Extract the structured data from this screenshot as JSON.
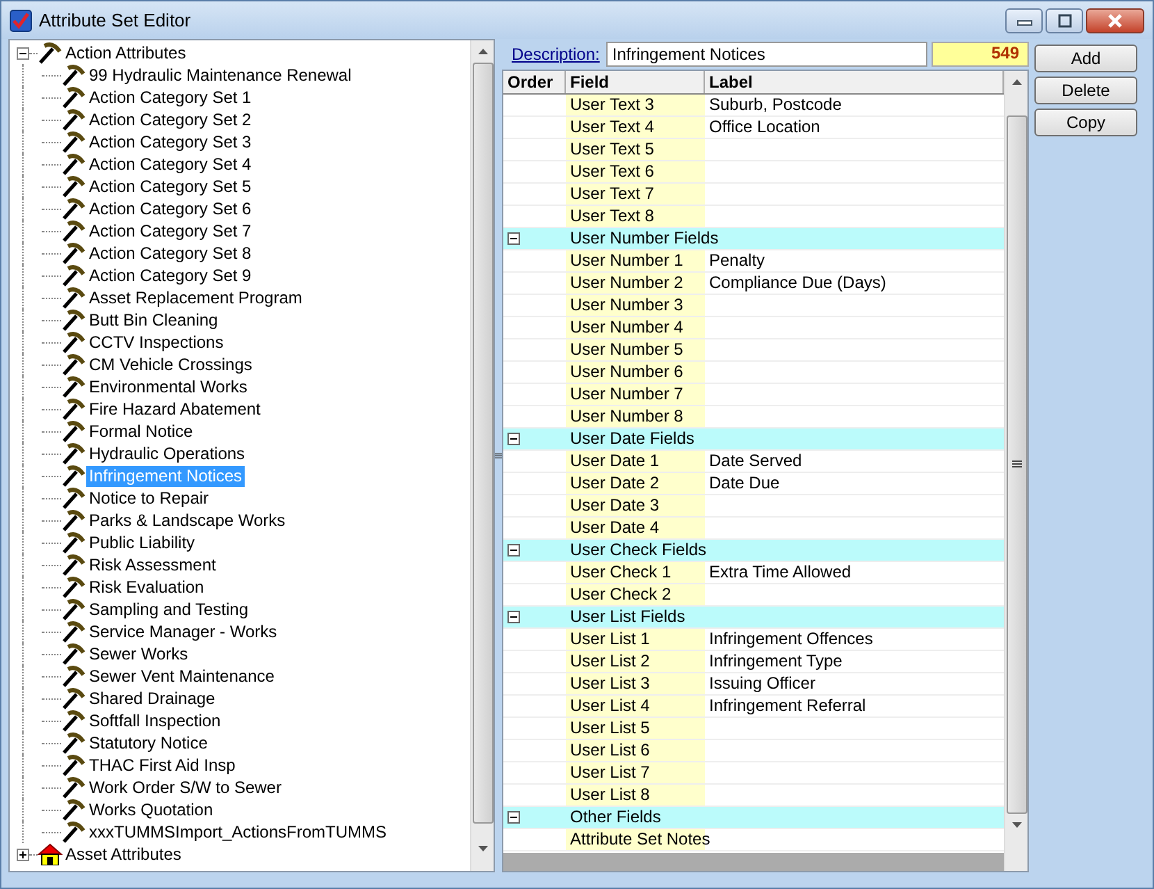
{
  "window": {
    "title": "Attribute Set Editor"
  },
  "tree": [
    {
      "label": "Action Attributes",
      "kind": "action",
      "expanded": true,
      "selected": false,
      "children": [
        {
          "label": "99 Hydraulic Maintenance Renewal",
          "selected": false
        },
        {
          "label": "Action Category Set 1",
          "selected": false
        },
        {
          "label": "Action Category Set 2",
          "selected": false
        },
        {
          "label": "Action Category Set 3",
          "selected": false
        },
        {
          "label": "Action Category Set 4",
          "selected": false
        },
        {
          "label": "Action Category Set 5",
          "selected": false
        },
        {
          "label": "Action Category Set 6",
          "selected": false
        },
        {
          "label": "Action Category Set 7",
          "selected": false
        },
        {
          "label": "Action Category Set 8",
          "selected": false
        },
        {
          "label": "Action Category Set 9",
          "selected": false
        },
        {
          "label": "Asset Replacement Program",
          "selected": false
        },
        {
          "label": "Butt Bin Cleaning",
          "selected": false
        },
        {
          "label": "CCTV Inspections",
          "selected": false
        },
        {
          "label": "CM Vehicle Crossings",
          "selected": false
        },
        {
          "label": "Environmental Works",
          "selected": false
        },
        {
          "label": "Fire Hazard Abatement",
          "selected": false
        },
        {
          "label": "Formal Notice",
          "selected": false
        },
        {
          "label": "Hydraulic Operations",
          "selected": false
        },
        {
          "label": "Infringement Notices",
          "selected": true
        },
        {
          "label": "Notice to Repair",
          "selected": false
        },
        {
          "label": "Parks & Landscape Works",
          "selected": false
        },
        {
          "label": "Public Liability",
          "selected": false
        },
        {
          "label": "Risk Assessment",
          "selected": false
        },
        {
          "label": "Risk Evaluation",
          "selected": false
        },
        {
          "label": "Sampling and Testing",
          "selected": false
        },
        {
          "label": "Service Manager - Works",
          "selected": false
        },
        {
          "label": "Sewer  Works",
          "selected": false
        },
        {
          "label": "Sewer Vent Maintenance",
          "selected": false
        },
        {
          "label": "Shared Drainage",
          "selected": false
        },
        {
          "label": "Softfall Inspection",
          "selected": false
        },
        {
          "label": "Statutory Notice",
          "selected": false
        },
        {
          "label": "THAC First Aid Insp",
          "selected": false
        },
        {
          "label": "Work Order S/W to Sewer",
          "selected": false
        },
        {
          "label": "Works Quotation",
          "selected": false
        },
        {
          "label": "xxxTUMMSImport_ActionsFromTUMMS",
          "selected": false
        }
      ]
    },
    {
      "label": "Asset Attributes",
      "kind": "asset",
      "expanded": false,
      "selected": false
    }
  ],
  "description": {
    "label": "Description:",
    "value": "Infringement Notices",
    "id_badge": "549"
  },
  "buttons": [
    "Add",
    "Delete",
    "Copy"
  ],
  "grid": {
    "columns": [
      "Order",
      "Field",
      "Label"
    ],
    "rows": [
      {
        "kind": "field",
        "field": "User Text 3",
        "label": "Suburb, Postcode"
      },
      {
        "kind": "field",
        "field": "User Text 4",
        "label": "Office Location"
      },
      {
        "kind": "field",
        "field": "User Text 5"
      },
      {
        "kind": "field",
        "field": "User Text 6"
      },
      {
        "kind": "field",
        "field": "User Text 7"
      },
      {
        "kind": "field",
        "field": "User Text 8"
      },
      {
        "kind": "group",
        "field": "User Number Fields",
        "expanded": true
      },
      {
        "kind": "field",
        "field": "User Number 1",
        "label": "Penalty"
      },
      {
        "kind": "field",
        "field": "User Number 2",
        "label": "Compliance Due (Days)"
      },
      {
        "kind": "field",
        "field": "User Number 3"
      },
      {
        "kind": "field",
        "field": "User Number 4"
      },
      {
        "kind": "field",
        "field": "User Number 5"
      },
      {
        "kind": "field",
        "field": "User Number 6"
      },
      {
        "kind": "field",
        "field": "User Number 7"
      },
      {
        "kind": "field",
        "field": "User Number 8"
      },
      {
        "kind": "group",
        "field": "User Date Fields",
        "expanded": true
      },
      {
        "kind": "field",
        "field": "User Date 1",
        "label": "Date Served"
      },
      {
        "kind": "field",
        "field": "User Date 2",
        "label": "Date Due"
      },
      {
        "kind": "field",
        "field": "User Date 3"
      },
      {
        "kind": "field",
        "field": "User Date 4"
      },
      {
        "kind": "group",
        "field": "User Check Fields",
        "expanded": true
      },
      {
        "kind": "field",
        "field": "User Check 1",
        "label": "Extra Time Allowed"
      },
      {
        "kind": "field",
        "field": "User Check 2"
      },
      {
        "kind": "group",
        "field": "User List Fields",
        "expanded": true
      },
      {
        "kind": "field",
        "field": "User List 1",
        "label": "Infringement Offences"
      },
      {
        "kind": "field",
        "field": "User List 2",
        "label": "Infringement Type"
      },
      {
        "kind": "field",
        "field": "User List 3",
        "label": "Issuing Officer"
      },
      {
        "kind": "field",
        "field": "User List 4",
        "label": "Infringement Referral"
      },
      {
        "kind": "field",
        "field": "User List 5"
      },
      {
        "kind": "field",
        "field": "User List 6"
      },
      {
        "kind": "field",
        "field": "User List 7"
      },
      {
        "kind": "field",
        "field": "User List 8"
      },
      {
        "kind": "group",
        "field": "Other Fields",
        "expanded": true
      },
      {
        "kind": "field",
        "field": "Attribute Set Notes"
      }
    ]
  }
}
